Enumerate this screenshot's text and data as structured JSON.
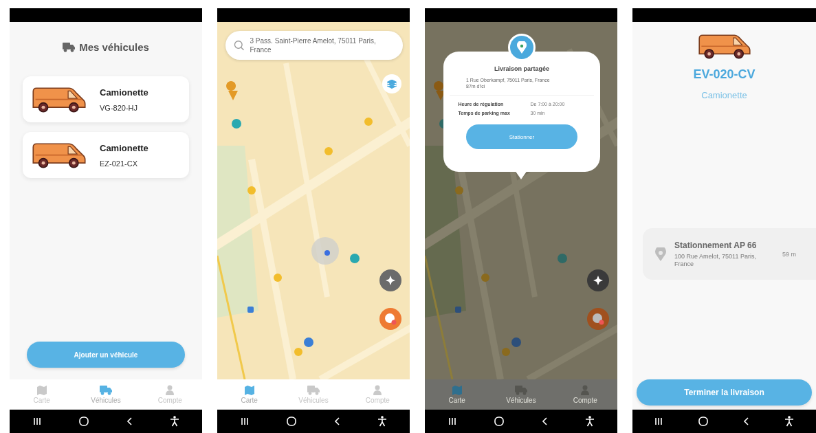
{
  "screens": [
    {
      "kind": "vehicles",
      "title": "Mes véhicules",
      "vehicles": [
        {
          "type": "Camionette",
          "plate": "VG-820-HJ"
        },
        {
          "type": "Camionette",
          "plate": "EZ-021-CX"
        }
      ],
      "action": "Ajouter un véhicule",
      "tabs": [
        {
          "label": "Carte",
          "selected": false
        },
        {
          "label": "Véhicules",
          "selected": true
        },
        {
          "label": "Compte",
          "selected": false
        }
      ]
    },
    {
      "kind": "map",
      "search": {
        "value": "3 Pass. Saint-Pierre Amelot, 75011 Paris, France"
      },
      "tabs": [
        {
          "label": "Carte",
          "selected": true
        },
        {
          "label": "Véhicules",
          "selected": false
        },
        {
          "label": "Compte",
          "selected": false
        }
      ]
    },
    {
      "kind": "map_popup",
      "popup": {
        "title": "Livraison partagée",
        "address": "1 Rue Oberkampf, 75011 Paris, France",
        "distance": "87m d'ici",
        "rows": [
          {
            "label": "Heure de régulation",
            "value": "De 7:00 à 20:00"
          },
          {
            "label": "Temps de parking max",
            "value": "30 min"
          }
        ],
        "action": "Stationner"
      },
      "tabs": [
        {
          "label": "Carte",
          "selected": true
        },
        {
          "label": "Véhicules",
          "selected": false
        },
        {
          "label": "Compte",
          "selected": false
        }
      ]
    },
    {
      "kind": "vehicle_detail",
      "plate": "EV-020-CV",
      "type": "Camionette",
      "parking": {
        "name": "Stationnement AP 66",
        "address": "100 Rue Amelot, 75011 Paris, France",
        "distance": "59 m"
      },
      "action": "Terminer la livraison"
    }
  ]
}
